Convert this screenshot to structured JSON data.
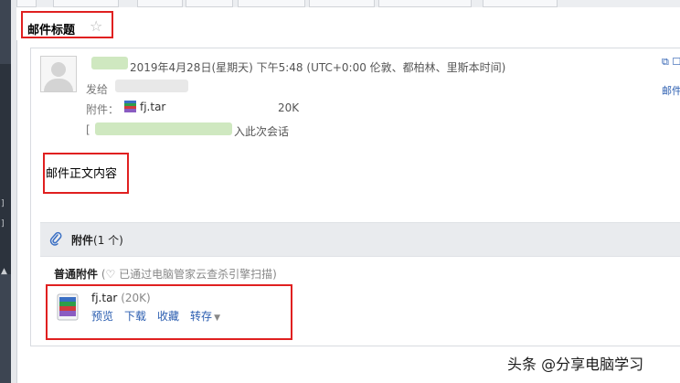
{
  "subject": {
    "title": "邮件标题",
    "star": "☆"
  },
  "header": {
    "sender": "",
    "datetime": "2019年4月28日(星期天) 下午5:48 (UTC+0:00 伦敦、都柏林、里斯本时间)",
    "to_label": "发给",
    "attachment_label": "附件：",
    "attachment_file": "fj.tar",
    "attachment_size": "20K",
    "session_prefix": "[",
    "session_text": "入此次会话"
  },
  "right_tools": {
    "top_icons": "⧉ ☐",
    "action": "邮件"
  },
  "body": {
    "text": "邮件正文内容"
  },
  "attachments": {
    "header_label": "附件",
    "count": "(1 个)",
    "section_title": "普通附件",
    "scan_note": "(♡ 已通过电脑管家云查杀引擎扫描)",
    "file": {
      "name": "fj.tar",
      "size": "(20K)",
      "actions": [
        "预览",
        "下载",
        "收藏",
        "转存"
      ]
    }
  },
  "watermark": "头条 @分享电脑学习",
  "colors": {
    "highlight": "#e02020",
    "link": "#2a5db0",
    "sidebar": "#3d4552"
  }
}
